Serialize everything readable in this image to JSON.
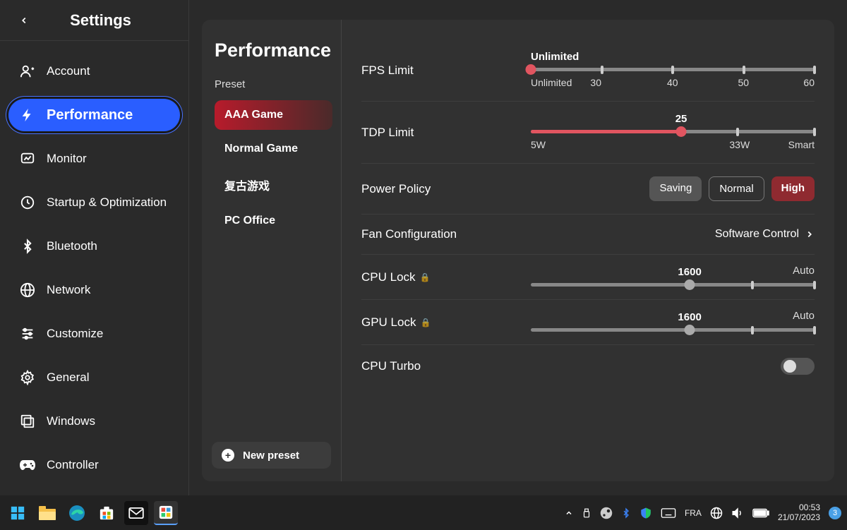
{
  "header": {
    "title": "Settings"
  },
  "sidebar": {
    "items": [
      {
        "label": "Account",
        "icon": "account"
      },
      {
        "label": "Performance",
        "icon": "bolt",
        "active": true
      },
      {
        "label": "Monitor",
        "icon": "monitor"
      },
      {
        "label": "Startup & Optimization",
        "icon": "startup"
      },
      {
        "label": "Bluetooth",
        "icon": "bluetooth"
      },
      {
        "label": "Network",
        "icon": "network"
      },
      {
        "label": "Customize",
        "icon": "customize"
      },
      {
        "label": "General",
        "icon": "general"
      },
      {
        "label": "Windows",
        "icon": "windows"
      },
      {
        "label": "Controller",
        "icon": "controller"
      }
    ]
  },
  "mid": {
    "title": "Performance",
    "preset_label": "Preset",
    "presets": [
      {
        "label": "AAA Game",
        "active": true
      },
      {
        "label": "Normal Game"
      },
      {
        "label": "复古游戏"
      },
      {
        "label": "PC Office"
      }
    ],
    "new_preset": "New preset"
  },
  "settings": {
    "fps": {
      "label": "FPS Limit",
      "value_label": "Unlimited",
      "ticks": [
        "Unlimited",
        "30",
        "40",
        "50",
        "60"
      ],
      "pos_pct": 0
    },
    "tdp": {
      "label": "TDP Limit",
      "value_label": "25",
      "ticks": [
        "5W",
        "33W",
        "Smart"
      ],
      "pos_pct": 53
    },
    "power": {
      "label": "Power Policy",
      "options": [
        "Saving",
        "Normal",
        "High"
      ],
      "selected": 2
    },
    "fan": {
      "label": "Fan Configuration",
      "value": "Software Control"
    },
    "cpulock": {
      "label": "CPU Lock",
      "value_label": "1600",
      "aux": "Auto",
      "pos_pct": 56
    },
    "gpulock": {
      "label": "GPU Lock",
      "value_label": "1600",
      "aux": "Auto",
      "pos_pct": 56
    },
    "turbo": {
      "label": "CPU Turbo",
      "on": false
    }
  },
  "taskbar": {
    "lang": "FRA",
    "time": "00:53",
    "date": "21/07/2023",
    "notifications": "3"
  }
}
